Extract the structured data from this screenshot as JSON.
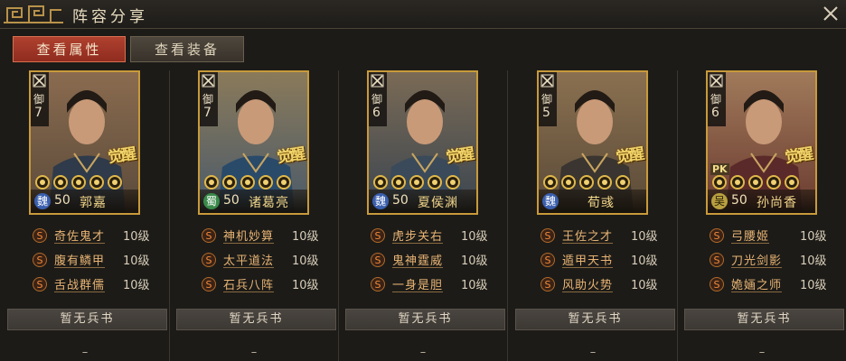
{
  "window": {
    "title": "阵容分享",
    "ornament_icon": "cloud-pattern-icon",
    "close_icon": "close-icon"
  },
  "tabs": [
    {
      "label": "查看属性",
      "active": true
    },
    {
      "label": "查看装备",
      "active": false
    }
  ],
  "colors": {
    "accent": "#b0412f",
    "card_border": "#c89a3a",
    "skill_text": "#e8b474",
    "name_text": "#f0d58a"
  },
  "heroes": [
    {
      "arm_type": "御",
      "arm_level": "7",
      "awaken": "觉醒",
      "pk": "",
      "stars": 5,
      "faction": "魏",
      "faction_class": "f-wei",
      "level": "50",
      "name": "郭嘉",
      "skills": [
        {
          "s": "S",
          "name": "奇佐鬼才",
          "level": "10级"
        },
        {
          "s": "S",
          "name": "腹有鳞甲",
          "level": "10级"
        },
        {
          "s": "S",
          "name": "舌战群儒",
          "level": "10级"
        }
      ],
      "book": "暂无兵书",
      "extra": "–"
    },
    {
      "arm_type": "御",
      "arm_level": "7",
      "awaken": "觉醒",
      "pk": "",
      "stars": 5,
      "faction": "蜀",
      "faction_class": "f-shu",
      "level": "50",
      "name": "诸葛亮",
      "skills": [
        {
          "s": "S",
          "name": "神机妙算",
          "level": "10级"
        },
        {
          "s": "S",
          "name": "太平道法",
          "level": "10级"
        },
        {
          "s": "S",
          "name": "石兵八阵",
          "level": "10级"
        }
      ],
      "book": "暂无兵书",
      "extra": "–"
    },
    {
      "arm_type": "御",
      "arm_level": "6",
      "awaken": "觉醒",
      "pk": "",
      "stars": 5,
      "faction": "魏",
      "faction_class": "f-wei",
      "level": "50",
      "name": "夏侯渊",
      "skills": [
        {
          "s": "S",
          "name": "虎步关右",
          "level": "10级"
        },
        {
          "s": "S",
          "name": "鬼神霆威",
          "level": "10级"
        },
        {
          "s": "S",
          "name": "一身是胆",
          "level": "10级"
        }
      ],
      "book": "暂无兵书",
      "extra": "–"
    },
    {
      "arm_type": "御",
      "arm_level": "5",
      "awaken": "觉醒",
      "pk": "",
      "stars": 5,
      "faction": "魏",
      "faction_class": "f-wei",
      "level": "",
      "name": "荀彧",
      "skills": [
        {
          "s": "S",
          "name": "王佐之才",
          "level": "10级"
        },
        {
          "s": "S",
          "name": "遁甲天书",
          "level": "10级"
        },
        {
          "s": "S",
          "name": "风助火势",
          "level": "10级"
        }
      ],
      "book": "暂无兵书",
      "extra": "–"
    },
    {
      "arm_type": "御",
      "arm_level": "6",
      "awaken": "觉醒",
      "pk": "PK",
      "stars": 5,
      "faction": "吴",
      "faction_class": "f-wu",
      "level": "50",
      "name": "孙尚香",
      "skills": [
        {
          "s": "S",
          "name": "弓腰姬",
          "level": "10级"
        },
        {
          "s": "S",
          "name": "刀光剑影",
          "level": "10级"
        },
        {
          "s": "S",
          "name": "姽婳之师",
          "level": "10级"
        }
      ],
      "book": "暂无兵书",
      "extra": "–"
    }
  ]
}
